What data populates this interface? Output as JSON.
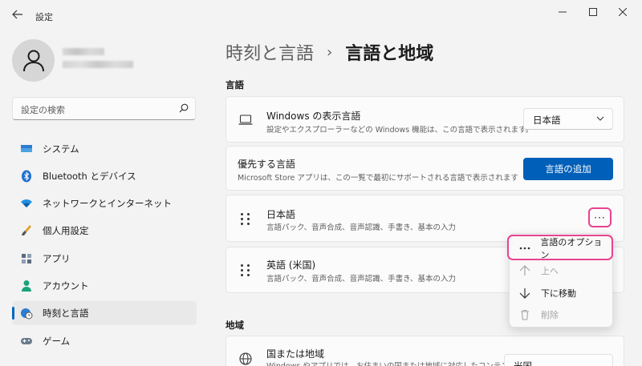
{
  "app": {
    "title": "設定"
  },
  "sidebar": {
    "search_placeholder": "設定の検索",
    "items": [
      {
        "label": "システム",
        "icon": "monitor-icon"
      },
      {
        "label": "Bluetooth とデバイス",
        "icon": "bluetooth-icon"
      },
      {
        "label": "ネットワークとインターネット",
        "icon": "wifi-icon"
      },
      {
        "label": "個人用設定",
        "icon": "brush-icon"
      },
      {
        "label": "アプリ",
        "icon": "apps-icon"
      },
      {
        "label": "アカウント",
        "icon": "account-icon"
      },
      {
        "label": "時刻と言語",
        "icon": "globe-clock-icon",
        "active": true
      },
      {
        "label": "ゲーム",
        "icon": "gamepad-icon"
      }
    ]
  },
  "breadcrumb": {
    "parent": "時刻と言語",
    "separator": "›",
    "current": "言語と地域"
  },
  "sections": {
    "language_title": "言語",
    "region_title": "地域"
  },
  "display_language": {
    "title": "Windows の表示言語",
    "desc": "設定やエクスプローラーなどの Windows 機能は、この言語で表示されます。",
    "value": "日本語"
  },
  "preferred_language": {
    "title": "優先する言語",
    "desc": "Microsoft Store アプリは、この一覧で最初にサポートされる言語で表示されます",
    "button": "言語の追加"
  },
  "languages": [
    {
      "name": "日本語",
      "features": "言語パック、音声合成、音声認識、手書き、基本の入力"
    },
    {
      "name": "英語 (米国)",
      "features": "言語パック、音声合成、音声認識、手書き、基本の入力"
    }
  ],
  "more_button": "···",
  "context_menu": [
    {
      "label": "言語のオプション",
      "icon": "more-icon",
      "enabled": true
    },
    {
      "label": "上へ",
      "icon": "arrow-up-icon",
      "enabled": false
    },
    {
      "label": "下に移動",
      "icon": "arrow-down-icon",
      "enabled": true
    },
    {
      "label": "削除",
      "icon": "trash-icon",
      "enabled": false
    }
  ],
  "region": {
    "title": "国または地域",
    "desc": "Windows やアプリでは、お住まいの国または地域に対応したコンテン",
    "value": "米国"
  },
  "colors": {
    "accent": "#005fb8",
    "highlight": "#e8438f",
    "active_bar": "#0067c0"
  }
}
